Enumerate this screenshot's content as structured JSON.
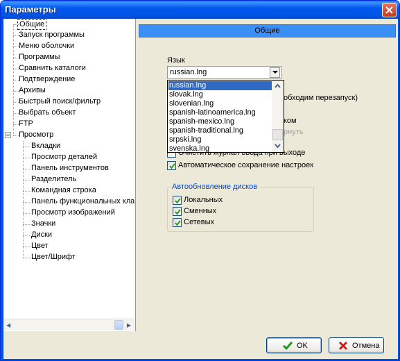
{
  "window": {
    "title": "Параметры"
  },
  "tree": {
    "items": [
      {
        "label": "Общие"
      },
      {
        "label": "Запуск программы"
      },
      {
        "label": "Меню оболочки"
      },
      {
        "label": "Программы"
      },
      {
        "label": "Сравнить каталоги"
      },
      {
        "label": "Подтверждение"
      },
      {
        "label": "Архивы"
      },
      {
        "label": "Быстрый поиск/фильтр"
      },
      {
        "label": "Выбрать объект"
      },
      {
        "label": "FTP"
      },
      {
        "label": "Просмотр"
      }
    ],
    "children": [
      {
        "label": "Вкладки"
      },
      {
        "label": "Просмотр деталей"
      },
      {
        "label": "Панель инструментов"
      },
      {
        "label": "Разделитель"
      },
      {
        "label": "Командная строка"
      },
      {
        "label": "Панель функциональных кла"
      },
      {
        "label": "Просмотр изображений"
      },
      {
        "label": "Значки"
      },
      {
        "label": "Диски"
      },
      {
        "label": "Цвет"
      },
      {
        "label": "Цвет/Шрифт"
      }
    ]
  },
  "section": {
    "title": "Общие"
  },
  "language": {
    "label": "Язык",
    "value": "russian.lng",
    "options": [
      "russian.lng",
      "slovak.lng",
      "slovenian.lng",
      "spanish-latinoamerica.lng",
      "spanish-mexico.lng",
      "spanish-traditional.lng",
      "srpski.lng",
      "svenska.lng"
    ]
  },
  "partial": {
    "restart_note": "обходим перезапуск)",
    "frag_kom": "ком",
    "frag_rnut": "рнуть"
  },
  "options": {
    "clear_log": "Очистить журнал ввода при выходе",
    "autosave": "Автоматическое сохранение настроек"
  },
  "auto_update": {
    "title": "Автообновление дисков",
    "items": [
      {
        "label": "Локальных",
        "checked": true
      },
      {
        "label": "Сменных",
        "checked": true
      },
      {
        "label": "Сетевых",
        "checked": true
      }
    ]
  },
  "buttons": {
    "ok": "OK",
    "cancel": "Отмена"
  }
}
